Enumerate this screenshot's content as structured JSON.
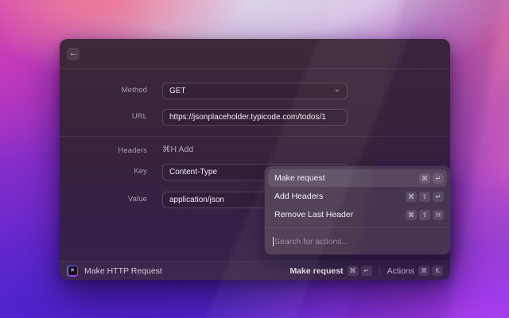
{
  "icons": {
    "back": "←",
    "chevron_down": "⌄",
    "extension_glyph": "✕"
  },
  "window": {
    "form": {
      "method": {
        "label": "Method",
        "value": "GET"
      },
      "url": {
        "label": "URL",
        "value": "https://jsonplaceholder.typicode.com/todos/1"
      },
      "headers": {
        "label": "Headers",
        "add_hint": "⌘H Add"
      },
      "key": {
        "label": "Key",
        "value": "Content-Type"
      },
      "value": {
        "label": "Value",
        "value": "application/json"
      }
    }
  },
  "action_panel": {
    "items": [
      {
        "label": "Make request",
        "keys": [
          "⌘",
          "↵"
        ],
        "selected": true
      },
      {
        "label": "Add Headers",
        "keys": [
          "⌘",
          "⇧",
          "↵"
        ],
        "selected": false
      },
      {
        "label": "Remove Last Header",
        "keys": [
          "⌘",
          "⇧",
          "H"
        ],
        "selected": false
      }
    ],
    "search_placeholder": "Search for actions..."
  },
  "status_bar": {
    "command_title": "Make HTTP Request",
    "primary_action": {
      "label": "Make request",
      "keys": [
        "⌘",
        "↵"
      ]
    },
    "actions_menu": {
      "label": "Actions",
      "keys": [
        "⌘",
        "K"
      ]
    }
  },
  "colors": {
    "accent_purple": "#7c2ede",
    "accent_magenta": "#cb3ab6",
    "window_bg_top": "#3d2939",
    "window_bg_bottom": "#382449",
    "panel_bg": "#4a3b51"
  }
}
